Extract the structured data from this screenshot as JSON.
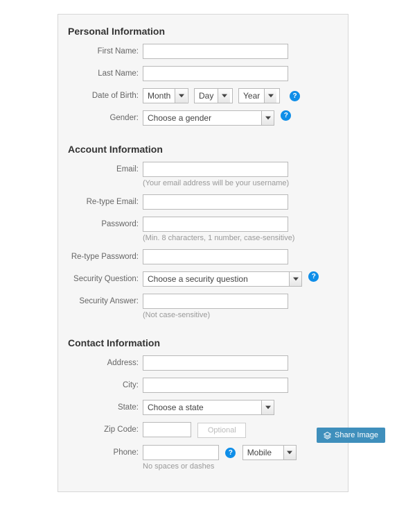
{
  "personal": {
    "title": "Personal Information",
    "first_name_label": "First Name:",
    "last_name_label": "Last Name:",
    "dob_label": "Date of Birth:",
    "dob_month": "Month",
    "dob_day": "Day",
    "dob_year": "Year",
    "gender_label": "Gender:",
    "gender_value": "Choose a gender"
  },
  "account": {
    "title": "Account Information",
    "email_label": "Email:",
    "email_hint": "(Your email address will be your username)",
    "retype_email_label": "Re-type Email:",
    "password_label": "Password:",
    "password_hint": "(Min. 8 characters, 1 number, case-sensitive)",
    "retype_password_label": "Re-type Password:",
    "sq_label": "Security Question:",
    "sq_value": "Choose a security question",
    "sa_label": "Security Answer:",
    "sa_hint": "(Not case-sensitive)"
  },
  "contact": {
    "title": "Contact Information",
    "address_label": "Address:",
    "city_label": "City:",
    "state_label": "State:",
    "state_value": "Choose a state",
    "zip_label": "Zip Code:",
    "zip_optional": "Optional",
    "phone_label": "Phone:",
    "phone_type": "Mobile",
    "phone_hint": "No spaces or dashes"
  },
  "help_glyph": "?",
  "share_label": "Share Image"
}
